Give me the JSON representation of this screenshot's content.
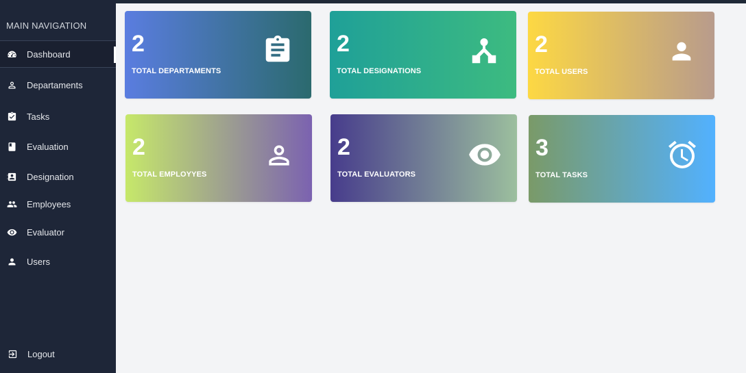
{
  "sidebar": {
    "title": "MAIN NAVIGATION",
    "items": [
      {
        "label": "Dashboard",
        "icon": "dashboard-icon",
        "active": true
      },
      {
        "label": "Departaments",
        "icon": "person-icon"
      },
      {
        "label": "Tasks",
        "icon": "clipboard-check-icon"
      },
      {
        "label": "Evaluation",
        "icon": "book-icon"
      },
      {
        "label": "Designation",
        "icon": "contact-card-icon"
      },
      {
        "label": "Employees",
        "icon": "people-icon"
      },
      {
        "label": "Evaluator",
        "icon": "eye-icon"
      },
      {
        "label": "Users",
        "icon": "user-icon"
      }
    ],
    "logout": {
      "label": "Logout",
      "icon": "logout-icon"
    }
  },
  "cards": [
    {
      "value": "2",
      "label": "TOTAL DEPARTAMENTS",
      "icon": "clipboard-icon",
      "colors": [
        "#5a7de0",
        "#2b6a6e"
      ]
    },
    {
      "value": "2",
      "label": "TOTAL DESIGNATIONS",
      "icon": "hierarchy-icon",
      "colors": [
        "#1fa098",
        "#3dbb80"
      ]
    },
    {
      "value": "2",
      "label": "TOTAL USERS",
      "icon": "user-icon",
      "colors": [
        "#fdd843",
        "#b89b8c"
      ]
    },
    {
      "value": "2",
      "label": "TOTAL EMPLOYYES",
      "icon": "person-outline-icon",
      "colors": [
        "#c6e86a",
        "#7b62b0"
      ]
    },
    {
      "value": "2",
      "label": "TOTAL EVALUATORS",
      "icon": "eye-icon",
      "colors": [
        "#473c8c",
        "#9cbf9e"
      ]
    },
    {
      "value": "3",
      "label": "TOTAL TASKS",
      "icon": "alarm-clock-icon",
      "colors": [
        "#7a9a68",
        "#52b1ff"
      ]
    }
  ]
}
